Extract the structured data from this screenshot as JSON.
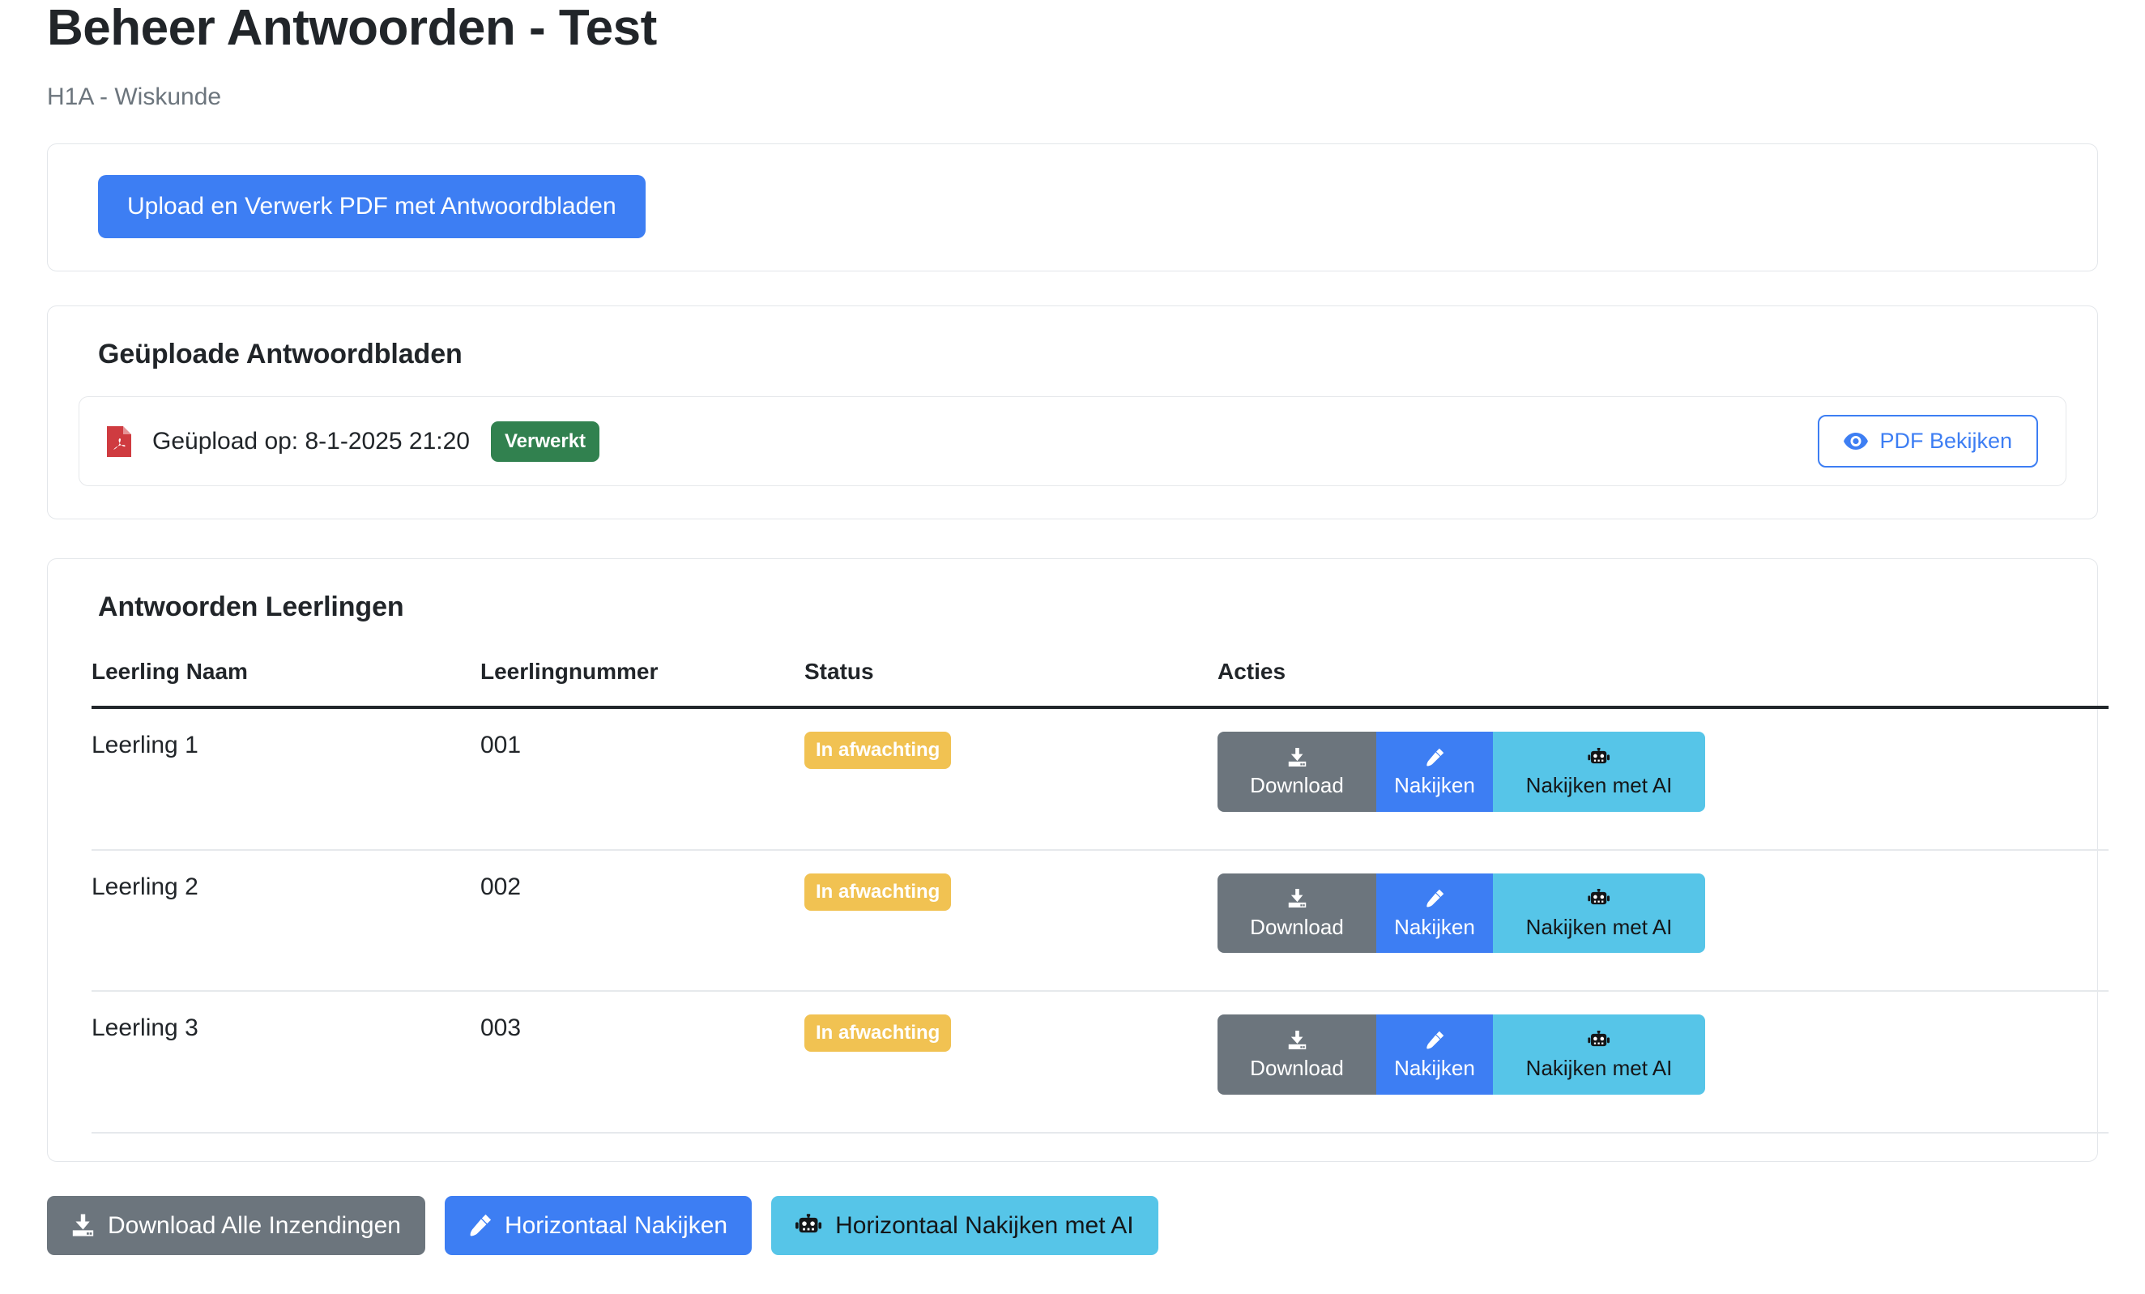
{
  "header": {
    "title": "Beheer Antwoorden - Test",
    "subtitle": "H1A - Wiskunde"
  },
  "upload_card": {
    "button_label": "Upload en Verwerk PDF met Antwoordbladen"
  },
  "sheets_card": {
    "heading": "Geüploade Antwoordbladen",
    "rows": [
      {
        "file_icon": "pdf-file-icon",
        "text": "Geüpload op: 8-1-2025 21:20",
        "status_badge": "Verwerkt",
        "view_button": {
          "icon": "eye-icon",
          "label": "PDF Bekijken"
        }
      }
    ]
  },
  "answers_card": {
    "heading": "Antwoorden Leerlingen",
    "columns": [
      "Leerling Naam",
      "Leerlingnummer",
      "Status",
      "Acties"
    ],
    "rows": [
      {
        "name": "Leerling 1",
        "number": "001",
        "status": "In afwachting",
        "actions": [
          {
            "icon": "download-icon",
            "glyph": "⬇",
            "label": "Download"
          },
          {
            "icon": "pen-icon",
            "glyph": "🖊",
            "label": "Nakijken"
          },
          {
            "icon": "robot-icon",
            "glyph": "🤖",
            "label": "Nakijken met AI"
          }
        ]
      },
      {
        "name": "Leerling 2",
        "number": "002",
        "status": "In afwachting",
        "actions": [
          {
            "icon": "download-icon",
            "glyph": "⬇",
            "label": "Download"
          },
          {
            "icon": "pen-icon",
            "glyph": "🖊",
            "label": "Nakijken"
          },
          {
            "icon": "robot-icon",
            "glyph": "🤖",
            "label": "Nakijken met AI"
          }
        ]
      },
      {
        "name": "Leerling 3",
        "number": "003",
        "status": "In afwachting",
        "actions": [
          {
            "icon": "download-icon",
            "glyph": "⬇",
            "label": "Download"
          },
          {
            "icon": "pen-icon",
            "glyph": "🖊",
            "label": "Nakijken"
          },
          {
            "icon": "robot-icon",
            "glyph": "🤖",
            "label": "Nakijken met AI"
          }
        ]
      }
    ]
  },
  "bottom_bar": {
    "buttons": [
      {
        "label": "Download Alle Inzendingen",
        "icon": "download-icon",
        "style": "gray"
      },
      {
        "label": "Horizontaal Nakijken",
        "icon": "pen-icon",
        "style": "blue"
      },
      {
        "label": "Horizontaal Nakijken met AI",
        "icon": "robot-icon",
        "style": "cyan"
      }
    ]
  },
  "colors": {
    "primary_blue": "#3d7ef3",
    "secondary_gray": "#6c757d",
    "ai_cyan": "#56c5e8",
    "success_green": "#31814f",
    "warning_yellow": "#f1c252",
    "pdf_red": "#cf3b40",
    "text_dark": "#212529",
    "muted_text": "#6c757d",
    "card_border": "#e3e6ea"
  }
}
